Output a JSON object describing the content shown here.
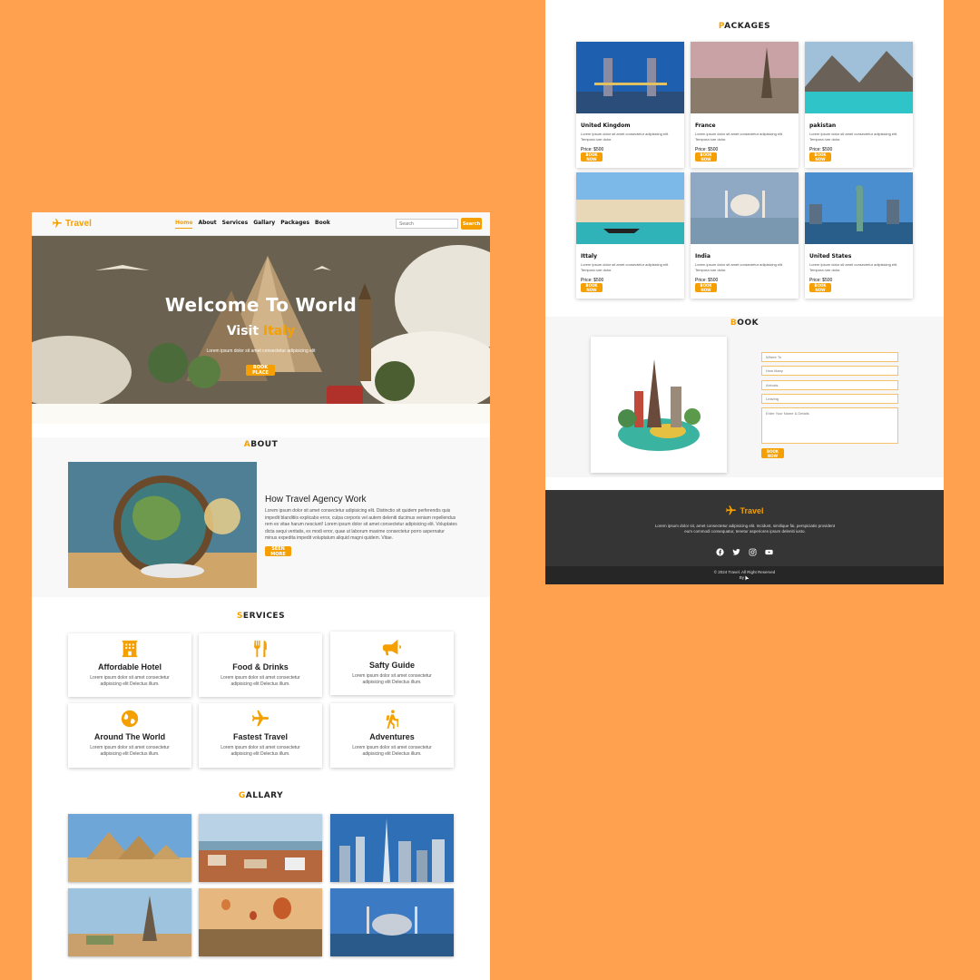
{
  "nav": {
    "brand": "Travel",
    "links": [
      "Home",
      "About",
      "Services",
      "Gallary",
      "Packages",
      "Book"
    ],
    "search_placeholder": "Search",
    "search_button": "Search"
  },
  "hero": {
    "title": "Welcome To World",
    "sub_prefix": "Visit",
    "sub_highlight": "Italy",
    "text": "Lorem ipsum dolor sit amet consectetur adipisicing elit",
    "button": "BOOK PLACE"
  },
  "about": {
    "title_first": "A",
    "title_rest": "BOUT",
    "heading": "How Travel Agency Work",
    "text": "Lorem ipsum dolor sit amet consectetur adipisicing elit. Distinctio sit quidem perferendis quis impedit blanditiis explicabo error, culpa corporis vel autem deleniti ducimus veniam repellendus rem ex vitae harum nesciunt! Lorem ipsum dolor sit amet consectetur adipisicing elit. Voluptates dicta sequi veritatis, ex modi error, quae ut laborum maxime consectetur porro aspernatur minus expedita impedit voluptatum aliquid magni quidem. Vitae.",
    "button": "SEEN MORE"
  },
  "services": {
    "title_first": "S",
    "title_rest": "ERVICES",
    "items": [
      {
        "title": "Affordable Hotel",
        "text": "Lorem ipsum dolor sit amet consectetur adipisicing elit Delectus illum.",
        "icon": "hotel-icon"
      },
      {
        "title": "Food & Drinks",
        "text": "Lorem ipsum dolor sit amet consectetur adipisicing elit Delectus illum.",
        "icon": "utensils-icon"
      },
      {
        "title": "Safty Guide",
        "text": "Lorem ipsum dolor sit amet consectetur adipisicing elit Delectus illum.",
        "icon": "bullhorn-icon"
      },
      {
        "title": "Around The World",
        "text": "Lorem ipsum dolor sit amet consectetur adipisicing elit Delectus illum.",
        "icon": "globe-icon"
      },
      {
        "title": "Fastest Travel",
        "text": "Lorem ipsum dolor sit amet consectetur adipisicing elit Delectus illum.",
        "icon": "plane-icon"
      },
      {
        "title": "Adventures",
        "text": "Lorem ipsum dolor sit amet consectetur adipisicing elit Delectus illum.",
        "icon": "hiking-icon"
      }
    ]
  },
  "gallery": {
    "title_first": "G",
    "title_rest": "ALLARY"
  },
  "packages": {
    "title_first": "P",
    "title_rest": "ACKAGES",
    "items": [
      {
        "name": "United Kingdom",
        "desc": "Lorem ipsum dolor sit amet consectetur adipisicing elit. Tempora iure dolor.",
        "price": "Price: $500",
        "button": "BOOK NOW"
      },
      {
        "name": "France",
        "desc": "Lorem ipsum dolor sit amet consectetur adipisicing elit. Tempora iure dolor.",
        "price": "Price: $500",
        "button": "BOOK NOW"
      },
      {
        "name": "pakistan",
        "desc": "Lorem ipsum dolor sit amet consectetur adipisicing elit. Tempora iure dolor.",
        "price": "Price: $500",
        "button": "BOOK NOW"
      },
      {
        "name": "Ittaly",
        "desc": "Lorem ipsum dolor sit amet consectetur adipisicing elit. Tempora iure dolor.",
        "price": "Price: $500",
        "button": "BOOK NOW"
      },
      {
        "name": "India",
        "desc": "Lorem ipsum dolor sit amet consectetur adipisicing elit. Tempora iure dolor.",
        "price": "Price: $500",
        "button": "BOOK NOW"
      },
      {
        "name": "United States",
        "desc": "Lorem ipsum dolor sit amet consectetur adipisicing elit. Tempora iure dolor.",
        "price": "Price: $500",
        "button": "BOOK NOW"
      }
    ]
  },
  "book": {
    "title_first": "B",
    "title_rest": "OOK",
    "fields": [
      "Where To",
      "How Many",
      "Arrivals",
      "Leaving"
    ],
    "textarea": "Enter Your Name & Details",
    "button": "BOOK NOW"
  },
  "footer": {
    "brand": "Travel",
    "text": "Lorem ipsum dolor sit, amet consectetur adipisicing elit. Incidunt, similique fai, perspiciatis provident eum commodi consequatur, tenetur asperiores ipsum deleniti iusto.",
    "copyright": "© 2024 Travel. All Right Reserved",
    "by": "By"
  },
  "colors": {
    "accent": "#f5a000",
    "background": "#ffa14f",
    "footer": "#353535"
  }
}
